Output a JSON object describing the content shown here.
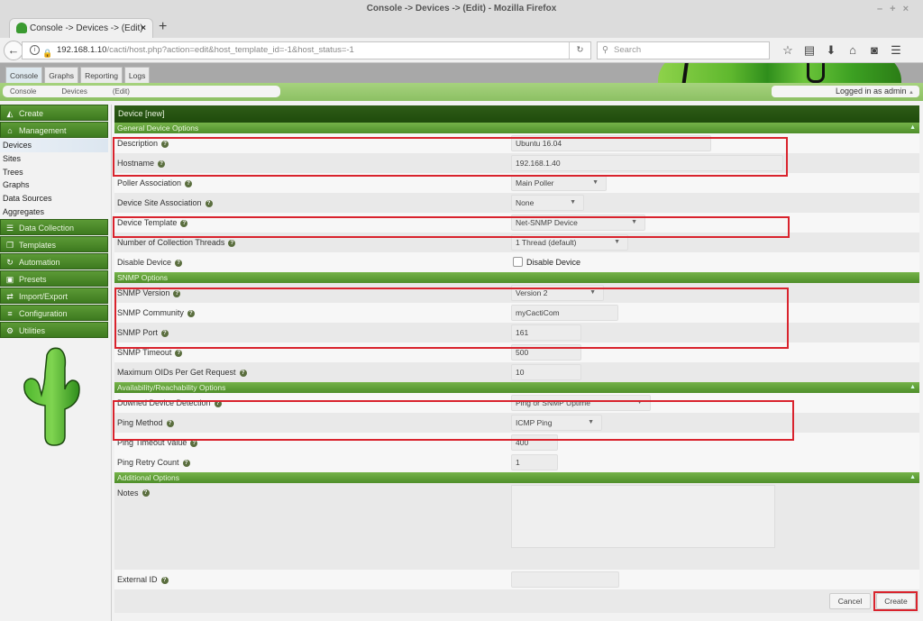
{
  "browser": {
    "window_title": "Console -> Devices -> (Edit) - Mozilla Firefox",
    "window_controls": [
      "–",
      "+",
      "×"
    ],
    "tab_title": "Console -> Devices -> (Edit)",
    "url_host": "192.168.1.10",
    "url_path": "/cacti/host.php?action=edit&host_template_id=-1&host_status=-1",
    "search_placeholder": "Search",
    "toolbar_icons": [
      "bookmark-star-icon",
      "reader-icon",
      "download-icon",
      "home-icon",
      "pocket-icon",
      "menu-icon"
    ]
  },
  "app": {
    "top_tabs": [
      "Console",
      "Graphs",
      "Reporting",
      "Logs"
    ],
    "active_tab": "Console",
    "breadcrumb": [
      "Console",
      "Devices",
      "(Edit)"
    ],
    "user_status": "Logged in as admin"
  },
  "sidebar": {
    "create": "Create",
    "management": "Management",
    "management_items": [
      "Devices",
      "Sites",
      "Trees",
      "Graphs",
      "Data Sources",
      "Aggregates"
    ],
    "selected_item": "Devices",
    "sections": [
      "Data Collection",
      "Templates",
      "Automation",
      "Presets",
      "Import/Export",
      "Configuration",
      "Utilities"
    ]
  },
  "form": {
    "title": "Device [new]",
    "general": {
      "header": "General Device Options",
      "description_label": "Description",
      "description_value": "Ubuntu 16.04",
      "hostname_label": "Hostname",
      "hostname_value": "192.168.1.40",
      "poller_label": "Poller Association",
      "poller_value": "Main Poller",
      "site_label": "Device Site Association",
      "site_value": "None",
      "template_label": "Device Template",
      "template_value": "Net-SNMP Device",
      "threads_label": "Number of Collection Threads",
      "threads_value": "1 Thread (default)",
      "disable_label": "Disable Device",
      "disable_checkbox_label": "Disable Device",
      "disable_checked": false
    },
    "snmp": {
      "header": "SNMP Options",
      "version_label": "SNMP Version",
      "version_value": "Version 2",
      "community_label": "SNMP Community",
      "community_value": "myCactiCom",
      "port_label": "SNMP Port",
      "port_value": "161",
      "timeout_label": "SNMP Timeout",
      "timeout_value": "500",
      "maxoids_label": "Maximum OIDs Per Get Request",
      "maxoids_value": "10"
    },
    "availability": {
      "header": "Availability/Reachability Options",
      "downed_label": "Downed Device Detection",
      "downed_value": "Ping or SNMP Uptime",
      "ping_method_label": "Ping Method",
      "ping_method_value": "ICMP Ping",
      "ping_timeout_label": "Ping Timeout Value",
      "ping_timeout_value": "400",
      "ping_retry_label": "Ping Retry Count",
      "ping_retry_value": "1"
    },
    "additional": {
      "header": "Additional Options",
      "notes_label": "Notes",
      "notes_value": "",
      "external_id_label": "External ID",
      "external_id_value": ""
    },
    "cancel_label": "Cancel",
    "create_label": "Create"
  },
  "annotation_color": "#d9232d"
}
